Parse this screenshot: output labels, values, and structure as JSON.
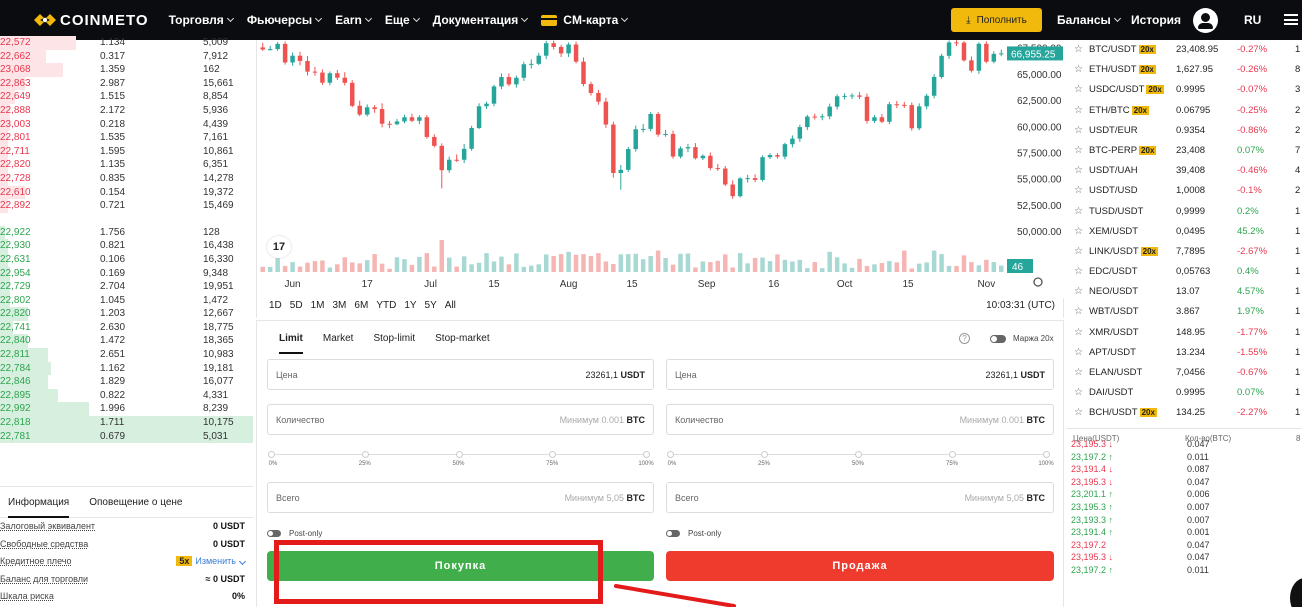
{
  "header": {
    "brand": "COINMETO",
    "nav": [
      "Торговля",
      "Фьючерсы",
      "Earn",
      "Еще",
      "Документация",
      "CM-карта"
    ],
    "deposit_label": "Пополнить",
    "balances_label": "Балансы",
    "history_label": "История",
    "lang": "RU",
    "accent_color": "#f0b90b"
  },
  "orderbook": {
    "asks": [
      {
        "price": "22,572",
        "amount": "1.134",
        "total": "5,009",
        "depth": 0.3
      },
      {
        "price": "22,662",
        "amount": "0.317",
        "total": "7,912",
        "depth": 0.18
      },
      {
        "price": "23,068",
        "amount": "1.359",
        "total": "162",
        "depth": 0.25
      },
      {
        "price": "22,863",
        "amount": "2.987",
        "total": "15,661",
        "depth": 0.1
      },
      {
        "price": "22,649",
        "amount": "1.515",
        "total": "8,854",
        "depth": 0.06
      },
      {
        "price": "22,888",
        "amount": "2.172",
        "total": "5,936",
        "depth": 0.04
      },
      {
        "price": "23,003",
        "amount": "0.218",
        "total": "4,439",
        "depth": 0.04
      },
      {
        "price": "22,801",
        "amount": "1.535",
        "total": "7,161",
        "depth": 0.03
      },
      {
        "price": "22,711",
        "amount": "1.595",
        "total": "10,861",
        "depth": 0.03
      },
      {
        "price": "22,820",
        "amount": "1.135",
        "total": "6,351",
        "depth": 0.03
      },
      {
        "price": "22,728",
        "amount": "0.835",
        "total": "14,278",
        "depth": 0.03
      },
      {
        "price": "22,610",
        "amount": "0.154",
        "total": "19,372",
        "depth": 0.1
      },
      {
        "price": "22,892",
        "amount": "0.721",
        "total": "15,469",
        "depth": 0.03
      }
    ],
    "bids": [
      {
        "price": "22,922",
        "amount": "1.756",
        "total": "128",
        "depth": 0.02
      },
      {
        "price": "22,930",
        "amount": "0.821",
        "total": "16,438",
        "depth": 0.03
      },
      {
        "price": "22,631",
        "amount": "0.106",
        "total": "16,330",
        "depth": 0.03
      },
      {
        "price": "22,954",
        "amount": "0.169",
        "total": "9,348",
        "depth": 0.04
      },
      {
        "price": "22,729",
        "amount": "2.704",
        "total": "19,951",
        "depth": 0.04
      },
      {
        "price": "22,802",
        "amount": "1.045",
        "total": "1,472",
        "depth": 0.04
      },
      {
        "price": "22,820",
        "amount": "1.203",
        "total": "12,667",
        "depth": 0.11
      },
      {
        "price": "22,741",
        "amount": "2.630",
        "total": "18,775",
        "depth": 0.05
      },
      {
        "price": "22,840",
        "amount": "1.472",
        "total": "18,365",
        "depth": 0.11
      },
      {
        "price": "22,811",
        "amount": "2.651",
        "total": "10,983",
        "depth": 0.19
      },
      {
        "price": "22,784",
        "amount": "1.162",
        "total": "19,181",
        "depth": 0.2
      },
      {
        "price": "22,846",
        "amount": "1.829",
        "total": "16,077",
        "depth": 0.19
      },
      {
        "price": "22,895",
        "amount": "0.822",
        "total": "4,331",
        "depth": 0.23
      },
      {
        "price": "22,992",
        "amount": "1.996",
        "total": "8,239",
        "depth": 0.35
      },
      {
        "price": "22,818",
        "amount": "1.711",
        "total": "10,175",
        "depth": 1.0
      },
      {
        "price": "22,781",
        "amount": "0.679",
        "total": "5,031",
        "depth": 1.0
      }
    ]
  },
  "info": {
    "tabs": [
      "Информация",
      "Оповещение о цене"
    ],
    "rows": [
      {
        "label": "Залоговый эквивалент",
        "value": "0 USDT"
      },
      {
        "label": "Свободные средства",
        "value": "0 USDT"
      },
      {
        "label": "Кредитное плечо",
        "badge": "5x",
        "link": "Изменить"
      },
      {
        "label": "Баланс для торговли",
        "value": "≈ 0 USDT"
      },
      {
        "label": "Шкала риска",
        "value": "0%"
      }
    ]
  },
  "chart_data": {
    "type": "candlestick",
    "ylim": [
      48000,
      69000
    ],
    "y_ticks": [
      "67,500.00",
      "65,000.00",
      "62,500.00",
      "60,000.00",
      "57,500.00",
      "55,000.00",
      "52,500.00",
      "50,000.00"
    ],
    "x_ticks": [
      "Jun",
      "17",
      "Jul",
      "15",
      "Aug",
      "15",
      "Sep",
      "16",
      "Oct",
      "15",
      "Nov"
    ],
    "last_price_label": "66,955.25",
    "volume_label": "46",
    "up_color": "#26a69a",
    "down_color": "#ef5350",
    "candles": [
      [
        67530,
        67968,
        67190,
        67330
      ],
      [
        67330,
        67681,
        67225,
        67370
      ],
      [
        67370,
        68049,
        67206,
        67863
      ],
      [
        67863,
        68097,
        65890,
        66093
      ],
      [
        66093,
        67029,
        65787,
        66735
      ],
      [
        66735,
        67111,
        65820,
        66235
      ],
      [
        66235,
        66718,
        64845,
        65218
      ],
      [
        65218,
        65677,
        64837,
        65125
      ],
      [
        65125,
        65426,
        63944,
        64161
      ],
      [
        64161,
        65231,
        63912,
        65065
      ],
      [
        65065,
        65383,
        64426,
        64640
      ],
      [
        64640,
        65160,
        63897,
        64149
      ],
      [
        64149,
        64407,
        61813,
        61961
      ],
      [
        61961,
        62449,
        60963,
        61112
      ],
      [
        61112,
        62091,
        60937,
        61812
      ],
      [
        61812,
        62032,
        61282,
        61646
      ],
      [
        61646,
        62197,
        59897,
        60245
      ],
      [
        60245,
        60521,
        59816,
        60197
      ],
      [
        60197,
        60689,
        60096,
        60463
      ],
      [
        60463,
        61112,
        60279,
        60861
      ],
      [
        60861,
        61204,
        60394,
        60524
      ],
      [
        60524,
        61063,
        60207,
        60864
      ],
      [
        60864,
        61076,
        58809,
        58982
      ],
      [
        58982,
        59226,
        57985,
        58134
      ],
      [
        58134,
        58371,
        54070,
        55810
      ],
      [
        55810,
        57102,
        55568,
        56805
      ],
      [
        56805,
        57321,
        56600,
        56804
      ],
      [
        56804,
        58302,
        56499,
        57848
      ],
      [
        57848,
        60043,
        57657,
        59835
      ],
      [
        59835,
        62193,
        59739,
        61913
      ],
      [
        61913,
        62344,
        61652,
        62160
      ],
      [
        62160,
        63957,
        61916,
        63804
      ],
      [
        63804,
        65049,
        63540,
        64702
      ],
      [
        64702,
        65052,
        63814,
        64001
      ],
      [
        64001,
        64839,
        63687,
        64632
      ],
      [
        64632,
        66154,
        64332,
        65922
      ],
      [
        65922,
        66389,
        65506,
        65960
      ],
      [
        65960,
        67010,
        65836,
        66741
      ],
      [
        66741,
        68159,
        66404,
        67934
      ],
      [
        67934,
        68183,
        67326,
        67575
      ],
      [
        67575,
        67773,
        66611,
        66958
      ],
      [
        66958,
        68003,
        66617,
        67809
      ],
      [
        67809,
        68083,
        65998,
        66169
      ],
      [
        66169,
        66573,
        63813,
        64031
      ],
      [
        64031,
        64237,
        62930,
        63179
      ],
      [
        63179,
        63478,
        62061,
        62347
      ],
      [
        62347,
        62727,
        59848,
        60166
      ],
      [
        60166,
        60441,
        55101,
        55542
      ],
      [
        55542,
        56309,
        53942,
        55843
      ],
      [
        55843,
        58039,
        55632,
        57827
      ],
      [
        57827,
        60066,
        57575,
        59716
      ],
      [
        59716,
        60215,
        59421,
        59749
      ],
      [
        59749,
        61359,
        59522,
        61176
      ],
      [
        61176,
        61355,
        58998,
        59208
      ],
      [
        59208,
        59659,
        58996,
        59269
      ],
      [
        59269,
        59587,
        56907,
        57111
      ],
      [
        57111,
        58070,
        56935,
        57888
      ],
      [
        57888,
        58319,
        57549,
        58012
      ],
      [
        58012,
        58393,
        56833,
        56951
      ],
      [
        56951,
        57321,
        56778,
        57186
      ],
      [
        57186,
        57496,
        55817,
        56009
      ],
      [
        56009,
        56399,
        55744,
        55967
      ],
      [
        55967,
        56209,
        54302,
        54442
      ],
      [
        54442,
        54838,
        53072,
        53332
      ],
      [
        53332,
        55131,
        53191,
        55024
      ],
      [
        55024,
        55368,
        54632,
        55051
      ],
      [
        55051,
        55418,
        54668,
        54879
      ],
      [
        54879,
        57215,
        54726,
        57046
      ],
      [
        57046,
        57426,
        56877,
        57255
      ],
      [
        57255,
        57445,
        56915,
        57106
      ],
      [
        57106,
        58431,
        56845,
        58291
      ],
      [
        58291,
        59128,
        57985,
        58823
      ],
      [
        58823,
        60153,
        58510,
        59924
      ],
      [
        59924,
        61092,
        59650,
        60927
      ],
      [
        60927,
        61206,
        60644,
        60851
      ],
      [
        60851,
        61196,
        60579,
        60946
      ],
      [
        60946,
        62162,
        60672,
        61875
      ],
      [
        61875,
        63035,
        61601,
        62861
      ],
      [
        62861,
        63158,
        62565,
        62901
      ],
      [
        62901,
        63143,
        62600,
        62945
      ],
      [
        62945,
        63259,
        62599,
        62817
      ],
      [
        62817,
        63126,
        60270,
        60514
      ],
      [
        60514,
        61081,
        60312,
        60861
      ],
      [
        60861,
        61176,
        60302,
        60432
      ],
      [
        60432,
        62318,
        60215,
        62105
      ],
      [
        62105,
        62415,
        61731,
        62047
      ],
      [
        62047,
        62320,
        61743,
        62021
      ],
      [
        62021,
        62275,
        59580,
        59807
      ],
      [
        59807,
        62185,
        59626,
        61902
      ],
      [
        61902,
        63113,
        61623,
        62916
      ],
      [
        62916,
        64978,
        62667,
        64705
      ],
      [
        64705,
        66924,
        64543,
        66726
      ],
      [
        66726,
        68188,
        66434,
        68005
      ],
      [
        68005,
        68224,
        67653,
        67985
      ],
      [
        67985,
        68139,
        66164,
        66294
      ],
      [
        66294,
        66672,
        65129,
        65302
      ],
      [
        65302,
        68008,
        65015,
        67872
      ],
      [
        67872,
        68113,
        66011,
        66168
      ],
      [
        66168,
        67160,
        66011,
        66912
      ],
      [
        66912,
        67331,
        66686,
        66957
      ]
    ],
    "volumes": [
      0.16,
      0.16,
      0.44,
      0.19,
      0.31,
      0.17,
      0.29,
      0.34,
      0.36,
      0.14,
      0.24,
      0.46,
      0.3,
      0.27,
      0.37,
      0.56,
      0.26,
      0.1,
      0.46,
      0.4,
      0.22,
      0.47,
      0.59,
      0.17,
      1,
      0.45,
      0.17,
      0.49,
      0.24,
      0.29,
      0.59,
      0.33,
      0.48,
      0.24,
      0.58,
      0.16,
      0.2,
      0.24,
      0.55,
      0.5,
      0.56,
      0.63,
      0.54,
      0.56,
      0.5,
      0.59,
      0.33,
      0.25,
      0.55,
      0.56,
      0.57,
      0.4,
      0.5,
      0.67,
      0.44,
      0.23,
      0.57,
      0.58,
      0.14,
      0.33,
      0.31,
      0.35,
      0.55,
      0.14,
      0.59,
      0.27,
      0.44,
      0.45,
      0.34,
      0.55,
      0.38,
      0.33,
      0.38,
      0.12,
      0.31,
      0.12,
      0.63,
      0.46,
      0.27,
      0.13,
      0.41,
      0.19,
      0.24,
      0.28,
      0.34,
      0.3,
      0.67,
      0.11,
      0.26,
      0.3,
      0.67,
      0.56,
      0.19,
      0.19,
      0.52,
      0.31,
      0.21,
      0.38,
      0.31,
      0.2,
      0.46
    ]
  },
  "chart_ranges": [
    "1D",
    "5D",
    "1M",
    "3M",
    "6M",
    "YTD",
    "1Y",
    "5Y",
    "All"
  ],
  "clock": "10:03:31 (UTC)",
  "order_form": {
    "tabs": [
      "Limit",
      "Market",
      "Stop-limit",
      "Stop-market"
    ],
    "margin_label": "Маржа 20x",
    "buy": {
      "price_label": "Цена",
      "price_value": "23261,1",
      "price_unit": "USDT",
      "qty_label": "Количество",
      "qty_hint": "Минимум 0.001",
      "qty_unit": "BTC",
      "total_label": "Всего",
      "total_hint": "Минимум 5,05",
      "total_unit": "BTC",
      "post_only": "Post-only",
      "button": "Покупка",
      "color": "#3fae4b"
    },
    "sell": {
      "price_label": "Цена",
      "price_value": "23261,1",
      "price_unit": "USDT",
      "qty_label": "Количество",
      "qty_hint": "Минимум 0.001",
      "qty_unit": "BTC",
      "total_label": "Всего",
      "total_hint": "Минимум 5,05",
      "total_unit": "BTC",
      "post_only": "Post-only",
      "button": "Продажа",
      "color": "#ef3b2d"
    },
    "slider_marks": [
      "0%",
      "25%",
      "50%",
      "75%",
      "100%"
    ]
  },
  "markets": [
    {
      "sym": "BTC/USDT",
      "badge": "20x",
      "price": "23,408.95",
      "chg": "-0.27%",
      "vol": "1"
    },
    {
      "sym": "ETH/USDT",
      "badge": "20x",
      "price": "1,627.95",
      "chg": "-0.26%",
      "vol": "8"
    },
    {
      "sym": "USDC/USDT",
      "badge": "20x",
      "price": "0.9995",
      "chg": "-0.07%",
      "vol": "3"
    },
    {
      "sym": "ETH/BTC",
      "badge": "20x",
      "price": "0.06795",
      "chg": "-0.25%",
      "vol": "2"
    },
    {
      "sym": "USDT/EUR",
      "badge": "",
      "price": "0.9354",
      "chg": "-0.86%",
      "vol": "2"
    },
    {
      "sym": "BTC-PERP",
      "badge": "20x",
      "price": "23,408",
      "chg": "0.07%",
      "vol": "7"
    },
    {
      "sym": "USDT/UAH",
      "badge": "",
      "price": "39,408",
      "chg": "-0.46%",
      "vol": "4"
    },
    {
      "sym": "USDT/USD",
      "badge": "",
      "price": "1,0008",
      "chg": "-0.1%",
      "vol": "2"
    },
    {
      "sym": "TUSD/USDT",
      "badge": "",
      "price": "0,9999",
      "chg": "0.2%",
      "vol": "1"
    },
    {
      "sym": "XEM/USDT",
      "badge": "",
      "price": "0,0495",
      "chg": "45.2%",
      "vol": "1"
    },
    {
      "sym": "LINK/USDT",
      "badge": "20x",
      "price": "7,7895",
      "chg": "-2.67%",
      "vol": "1"
    },
    {
      "sym": "EDC/USDT",
      "badge": "",
      "price": "0,05763",
      "chg": "0.4%",
      "vol": "1"
    },
    {
      "sym": "NEO/USDT",
      "badge": "",
      "price": "13.07",
      "chg": "4.57%",
      "vol": "1"
    },
    {
      "sym": "WBT/USDT",
      "badge": "",
      "price": "3.867",
      "chg": "1.97%",
      "vol": "1"
    },
    {
      "sym": "XMR/USDT",
      "badge": "",
      "price": "148.95",
      "chg": "-1.77%",
      "vol": "1"
    },
    {
      "sym": "APT/USDT",
      "badge": "",
      "price": "13.234",
      "chg": "-1.55%",
      "vol": "1"
    },
    {
      "sym": "ELAN/USDT",
      "badge": "",
      "price": "7,0456",
      "chg": "-0.67%",
      "vol": "1"
    },
    {
      "sym": "DAI/USDT",
      "badge": "",
      "price": "0.9995",
      "chg": "0.07%",
      "vol": "1"
    },
    {
      "sym": "BCH/USDT",
      "badge": "20x",
      "price": "134.25",
      "chg": "-2.27%",
      "vol": "1"
    }
  ],
  "trades": {
    "headers": [
      "Цена(USDT)",
      "Кол-во(BTC)",
      "8"
    ],
    "rows": [
      {
        "price": "23,195.3 ↓",
        "qty": "0.047",
        "dir": "down"
      },
      {
        "price": "23,197.2 ↑",
        "qty": "0.011",
        "dir": "up"
      },
      {
        "price": "23,191.4 ↓",
        "qty": "0.087",
        "dir": "down"
      },
      {
        "price": "23,195.3 ↓",
        "qty": "0.047",
        "dir": "down"
      },
      {
        "price": "23,201.1 ↑",
        "qty": "0.006",
        "dir": "up"
      },
      {
        "price": "23,195.3 ↑",
        "qty": "0.007",
        "dir": "up"
      },
      {
        "price": "23,193.3 ↑",
        "qty": "0.007",
        "dir": "up"
      },
      {
        "price": "23,191.4 ↑",
        "qty": "0.001",
        "dir": "up"
      },
      {
        "price": "23,197.2",
        "qty": "0.047",
        "dir": "down"
      },
      {
        "price": "23,195.3 ↓",
        "qty": "0.047",
        "dir": "down"
      },
      {
        "price": "23,197.2 ↑",
        "qty": "0.011",
        "dir": "up"
      }
    ]
  }
}
